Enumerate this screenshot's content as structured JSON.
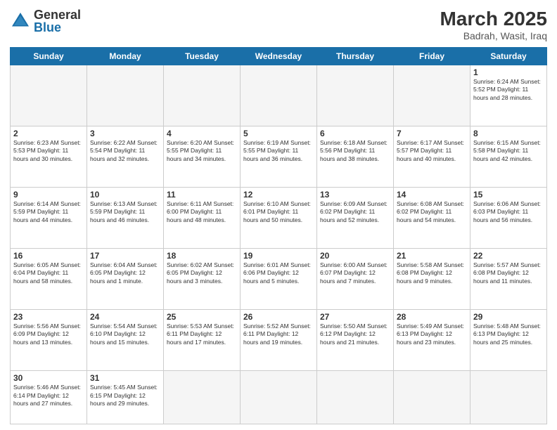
{
  "header": {
    "logo_general": "General",
    "logo_blue": "Blue",
    "month_year": "March 2025",
    "location": "Badrah, Wasit, Iraq"
  },
  "days_of_week": [
    "Sunday",
    "Monday",
    "Tuesday",
    "Wednesday",
    "Thursday",
    "Friday",
    "Saturday"
  ],
  "weeks": [
    [
      {
        "num": "",
        "info": ""
      },
      {
        "num": "",
        "info": ""
      },
      {
        "num": "",
        "info": ""
      },
      {
        "num": "",
        "info": ""
      },
      {
        "num": "",
        "info": ""
      },
      {
        "num": "",
        "info": ""
      },
      {
        "num": "1",
        "info": "Sunrise: 6:24 AM\nSunset: 5:52 PM\nDaylight: 11 hours\nand 28 minutes."
      }
    ],
    [
      {
        "num": "2",
        "info": "Sunrise: 6:23 AM\nSunset: 5:53 PM\nDaylight: 11 hours\nand 30 minutes."
      },
      {
        "num": "3",
        "info": "Sunrise: 6:22 AM\nSunset: 5:54 PM\nDaylight: 11 hours\nand 32 minutes."
      },
      {
        "num": "4",
        "info": "Sunrise: 6:20 AM\nSunset: 5:55 PM\nDaylight: 11 hours\nand 34 minutes."
      },
      {
        "num": "5",
        "info": "Sunrise: 6:19 AM\nSunset: 5:55 PM\nDaylight: 11 hours\nand 36 minutes."
      },
      {
        "num": "6",
        "info": "Sunrise: 6:18 AM\nSunset: 5:56 PM\nDaylight: 11 hours\nand 38 minutes."
      },
      {
        "num": "7",
        "info": "Sunrise: 6:17 AM\nSunset: 5:57 PM\nDaylight: 11 hours\nand 40 minutes."
      },
      {
        "num": "8",
        "info": "Sunrise: 6:15 AM\nSunset: 5:58 PM\nDaylight: 11 hours\nand 42 minutes."
      }
    ],
    [
      {
        "num": "9",
        "info": "Sunrise: 6:14 AM\nSunset: 5:59 PM\nDaylight: 11 hours\nand 44 minutes."
      },
      {
        "num": "10",
        "info": "Sunrise: 6:13 AM\nSunset: 5:59 PM\nDaylight: 11 hours\nand 46 minutes."
      },
      {
        "num": "11",
        "info": "Sunrise: 6:11 AM\nSunset: 6:00 PM\nDaylight: 11 hours\nand 48 minutes."
      },
      {
        "num": "12",
        "info": "Sunrise: 6:10 AM\nSunset: 6:01 PM\nDaylight: 11 hours\nand 50 minutes."
      },
      {
        "num": "13",
        "info": "Sunrise: 6:09 AM\nSunset: 6:02 PM\nDaylight: 11 hours\nand 52 minutes."
      },
      {
        "num": "14",
        "info": "Sunrise: 6:08 AM\nSunset: 6:02 PM\nDaylight: 11 hours\nand 54 minutes."
      },
      {
        "num": "15",
        "info": "Sunrise: 6:06 AM\nSunset: 6:03 PM\nDaylight: 11 hours\nand 56 minutes."
      }
    ],
    [
      {
        "num": "16",
        "info": "Sunrise: 6:05 AM\nSunset: 6:04 PM\nDaylight: 11 hours\nand 58 minutes."
      },
      {
        "num": "17",
        "info": "Sunrise: 6:04 AM\nSunset: 6:05 PM\nDaylight: 12 hours\nand 1 minute."
      },
      {
        "num": "18",
        "info": "Sunrise: 6:02 AM\nSunset: 6:05 PM\nDaylight: 12 hours\nand 3 minutes."
      },
      {
        "num": "19",
        "info": "Sunrise: 6:01 AM\nSunset: 6:06 PM\nDaylight: 12 hours\nand 5 minutes."
      },
      {
        "num": "20",
        "info": "Sunrise: 6:00 AM\nSunset: 6:07 PM\nDaylight: 12 hours\nand 7 minutes."
      },
      {
        "num": "21",
        "info": "Sunrise: 5:58 AM\nSunset: 6:08 PM\nDaylight: 12 hours\nand 9 minutes."
      },
      {
        "num": "22",
        "info": "Sunrise: 5:57 AM\nSunset: 6:08 PM\nDaylight: 12 hours\nand 11 minutes."
      }
    ],
    [
      {
        "num": "23",
        "info": "Sunrise: 5:56 AM\nSunset: 6:09 PM\nDaylight: 12 hours\nand 13 minutes."
      },
      {
        "num": "24",
        "info": "Sunrise: 5:54 AM\nSunset: 6:10 PM\nDaylight: 12 hours\nand 15 minutes."
      },
      {
        "num": "25",
        "info": "Sunrise: 5:53 AM\nSunset: 6:11 PM\nDaylight: 12 hours\nand 17 minutes."
      },
      {
        "num": "26",
        "info": "Sunrise: 5:52 AM\nSunset: 6:11 PM\nDaylight: 12 hours\nand 19 minutes."
      },
      {
        "num": "27",
        "info": "Sunrise: 5:50 AM\nSunset: 6:12 PM\nDaylight: 12 hours\nand 21 minutes."
      },
      {
        "num": "28",
        "info": "Sunrise: 5:49 AM\nSunset: 6:13 PM\nDaylight: 12 hours\nand 23 minutes."
      },
      {
        "num": "29",
        "info": "Sunrise: 5:48 AM\nSunset: 6:13 PM\nDaylight: 12 hours\nand 25 minutes."
      }
    ],
    [
      {
        "num": "30",
        "info": "Sunrise: 5:46 AM\nSunset: 6:14 PM\nDaylight: 12 hours\nand 27 minutes."
      },
      {
        "num": "31",
        "info": "Sunrise: 5:45 AM\nSunset: 6:15 PM\nDaylight: 12 hours\nand 29 minutes."
      },
      {
        "num": "",
        "info": ""
      },
      {
        "num": "",
        "info": ""
      },
      {
        "num": "",
        "info": ""
      },
      {
        "num": "",
        "info": ""
      },
      {
        "num": "",
        "info": ""
      }
    ]
  ]
}
